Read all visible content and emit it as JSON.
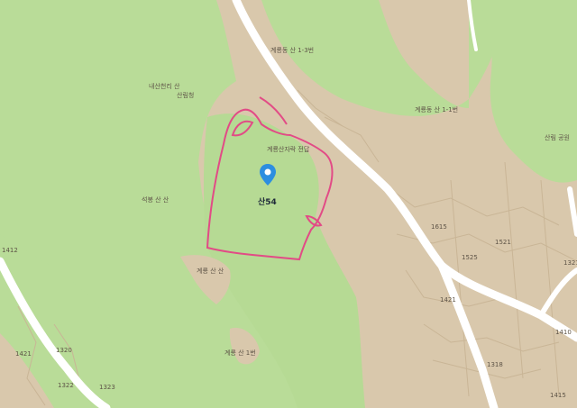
{
  "map": {
    "colors": {
      "land": "#d9c8ac",
      "green": "#b9dc98",
      "green_dark": "#a8d088",
      "road": "#ffffff",
      "boundary": "#e24b86",
      "pin": "#2d8ee0"
    },
    "parcel_label": "산54",
    "labels": {
      "l1": "계룡동 산 1-3번",
      "l2": "내산천리 산",
      "l3": "산림청",
      "l4": "계룡동 산 1-1번",
      "l5": "석봉 산 산",
      "l6": "계룡산자락 전답",
      "l7": "산림 공원",
      "l8": "계룡 산 산",
      "l9": "계룡 산 1번",
      "n1": "1615",
      "n2": "1521",
      "n3": "1525",
      "n4": "1321",
      "n5": "1410",
      "n6": "1412",
      "n7": "1421",
      "n8": "1320",
      "n9": "1322",
      "n10": "1318",
      "n11": "1323",
      "n12": "1421",
      "n13": "1415"
    }
  }
}
